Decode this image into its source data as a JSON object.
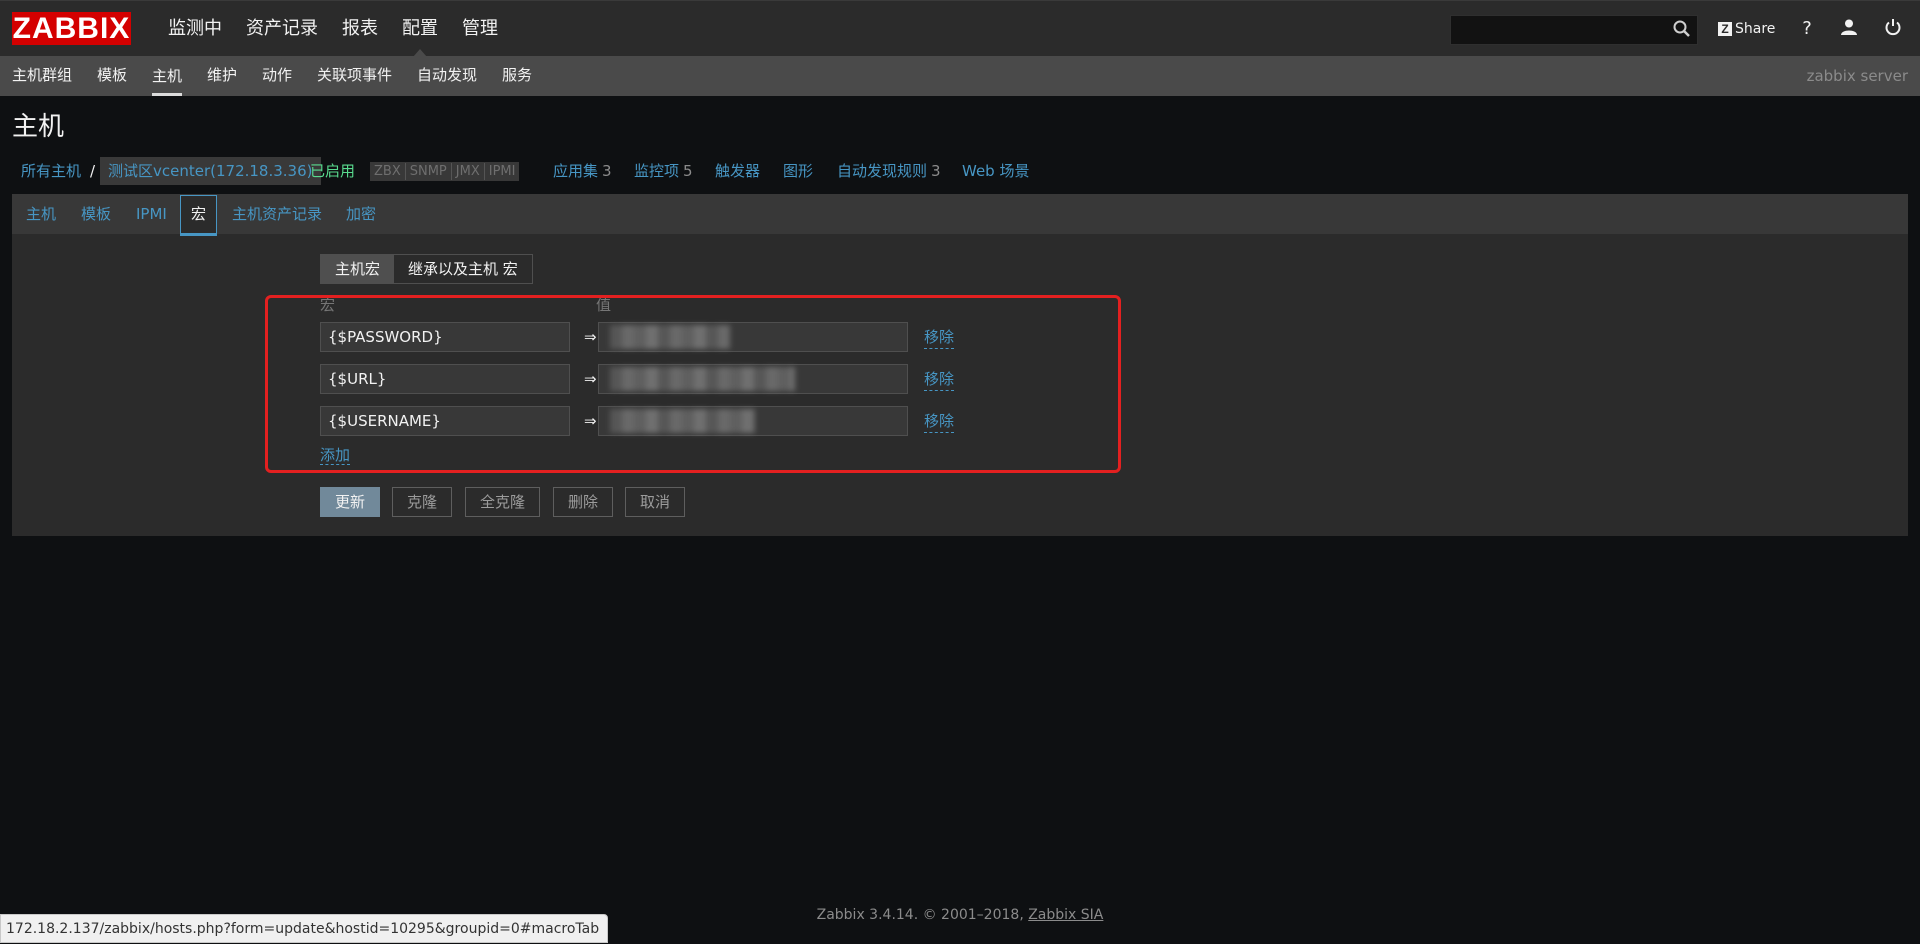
{
  "logo": "ZABBIX",
  "main_menu": [
    "监测中",
    "资产记录",
    "报表",
    "配置",
    "管理"
  ],
  "main_menu_active": "配置",
  "search": {
    "value": "",
    "placeholder": ""
  },
  "share_label": "Share",
  "help_label": "?",
  "sub_menu": [
    "主机群组",
    "模板",
    "主机",
    "维护",
    "动作",
    "关联项事件",
    "自动发现",
    "服务"
  ],
  "sub_menu_active": "主机",
  "server_name": "zabbix server",
  "page_title": "主机",
  "breadcrumb": {
    "all_hosts": "所有主机",
    "separator": "/",
    "host": "测试区vcenter(172.18.3.36)",
    "status": "已启用",
    "availability": [
      "ZBX",
      "SNMP",
      "JMX",
      "IPMI"
    ],
    "links": [
      {
        "label": "应用集",
        "count": "3"
      },
      {
        "label": "监控项",
        "count": "5"
      },
      {
        "label": "触发器",
        "count": ""
      },
      {
        "label": "图形",
        "count": ""
      },
      {
        "label": "自动发现规则",
        "count": "3"
      },
      {
        "label": "Web 场景",
        "count": ""
      }
    ]
  },
  "tabs": [
    "主机",
    "模板",
    "IPMI",
    "宏",
    "主机资产记录",
    "加密"
  ],
  "active_tab": "宏",
  "macro_view": {
    "host_macros": "主机宏",
    "inherited": "继承以及主机 宏"
  },
  "columns": {
    "macro": "宏",
    "value": "值"
  },
  "macros": [
    {
      "macro": "{$PASSWORD}",
      "arrow": "⇒",
      "value": "",
      "remove": "移除"
    },
    {
      "macro": "{$URL}",
      "arrow": "⇒",
      "value": "",
      "remove": "移除"
    },
    {
      "macro": "{$USERNAME}",
      "arrow": "⇒",
      "value": "",
      "remove": "移除"
    }
  ],
  "add_label": "添加",
  "buttons": {
    "update": "更新",
    "clone": "克隆",
    "full_clone": "全克隆",
    "delete": "删除",
    "cancel": "取消"
  },
  "footer": {
    "text": "Zabbix 3.4.14. © 2001–2018, ",
    "company": "Zabbix SIA"
  },
  "status_url": "172.18.2.137/zabbix/hosts.php?form=update&hostid=10295&groupid=0#macroTab"
}
